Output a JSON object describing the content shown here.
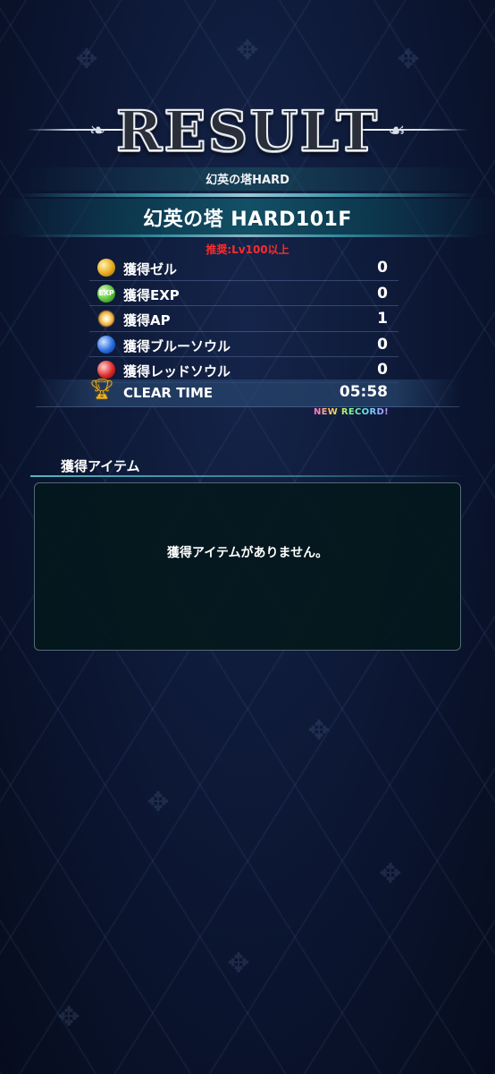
{
  "header": {
    "title": "RESULT",
    "subtitle": "幻英の塔HARD",
    "stage_name": "幻英の塔 HARD101F",
    "recommendation": "推奨:Lv100以上"
  },
  "rewards": [
    {
      "label": "獲得ゼル",
      "value": "0",
      "icon": "zel-coin-icon"
    },
    {
      "label": "獲得EXP",
      "value": "0",
      "icon": "exp-icon"
    },
    {
      "label": "獲得AP",
      "value": "1",
      "icon": "ap-spark-icon"
    },
    {
      "label": "獲得ブルーソウル",
      "value": "0",
      "icon": "blue-soul-icon"
    },
    {
      "label": "獲得レッドソウル",
      "value": "0",
      "icon": "red-soul-icon"
    }
  ],
  "clear_time": {
    "label": "CLEAR TIME",
    "value": "05:58",
    "badge": "NEW RECORD!",
    "icon": "trophy-icon"
  },
  "items_section": {
    "heading": "獲得アイテム",
    "empty_message": "獲得アイテムがありません。"
  },
  "exp_icon_text": "EXP",
  "colors": {
    "background": "#0b1530",
    "accent_teal": "#3fb6c4",
    "recommend_red": "#ff2a2a",
    "panel_bg": "#04181c"
  }
}
